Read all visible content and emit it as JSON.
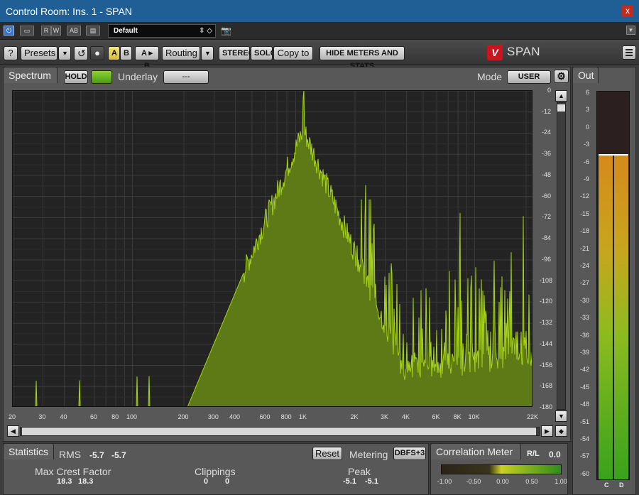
{
  "window": {
    "title": "Control Room: Ins. 1 - SPAN",
    "close": "x"
  },
  "host": {
    "buttons": [
      "R",
      "W",
      "AB"
    ],
    "preset": "Default"
  },
  "toolbar": {
    "help": "?",
    "presets": "Presets",
    "a": "A",
    "b": "B",
    "ab": "A ▸ B",
    "routing": "Routing",
    "stereo": "STEREO",
    "solo": "SOLO",
    "copy": "Copy to",
    "hide": "HIDE METERS AND STATS",
    "app": "SPAN",
    "logo": "V"
  },
  "spectrum": {
    "tab": "Spectrum",
    "hold": "HOLD",
    "underlay_label": "Underlay",
    "underlay_value": "---",
    "mode_label": "Mode",
    "mode_value": "USER",
    "db_labels": [
      "0",
      "-12",
      "-24",
      "-36",
      "-48",
      "-60",
      "-72",
      "-84",
      "-96",
      "-108",
      "-120",
      "-132",
      "-144",
      "-156",
      "-168",
      "-180"
    ],
    "freq_labels": [
      "20",
      "30",
      "40",
      "60",
      "80",
      "100",
      "200",
      "300",
      "400",
      "600",
      "800",
      "1K",
      "2K",
      "3K",
      "4K",
      "6K",
      "8K",
      "10K",
      "22K"
    ]
  },
  "chart_data": {
    "type": "area",
    "xscale": "log",
    "xlim": [
      20,
      22000
    ],
    "ylim": [
      -180,
      0
    ],
    "peak_frequency": 1000,
    "peak_level": 0,
    "color": "#a7d41a"
  },
  "statistics": {
    "tab": "Statistics",
    "rms_label": "RMS",
    "rms_l": "-5.7",
    "rms_r": "-5.7",
    "reset": "Reset",
    "metering_label": "Metering",
    "metering_value": "DBFS+3",
    "crest_label": "Max Crest Factor",
    "crest_l": "18.3",
    "crest_r": "18.3",
    "clip_label": "Clippings",
    "clip_l": "0",
    "clip_r": "0",
    "peak_label": "Peak",
    "peak_l": "-5.1",
    "peak_r": "-5.1"
  },
  "correlation": {
    "tab": "Correlation Meter",
    "rl_label": "R/L",
    "value": "0.0",
    "scale": [
      "-1.00",
      "-0.50",
      "0.00",
      "0.50",
      "1.00"
    ]
  },
  "out_meter": {
    "tab": "Out",
    "scale": [
      "6",
      "3",
      "0",
      "-3",
      "-6",
      "-9",
      "-12",
      "-15",
      "-18",
      "-21",
      "-24",
      "-27",
      "-30",
      "-33",
      "-36",
      "-39",
      "-42",
      "-45",
      "-48",
      "-51",
      "-54",
      "-57",
      "-60"
    ],
    "channels": [
      "C",
      "D"
    ],
    "level_db": -5.1
  }
}
